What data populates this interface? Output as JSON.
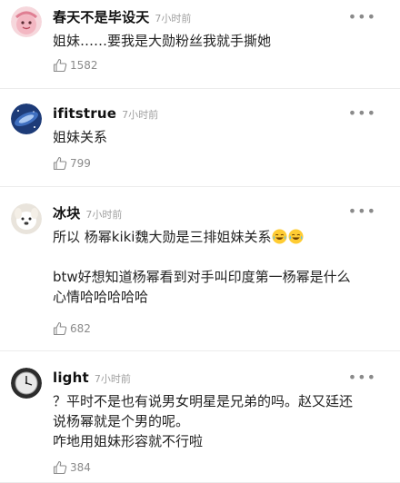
{
  "comments": [
    {
      "username": "春天不是毕设天",
      "time": "7小时前",
      "text_lines": [
        "姐妹……要我是大勋粉丝我就手撕她"
      ],
      "likes": "1582",
      "avatar_icon": "pink-character-avatar"
    },
    {
      "username": "ifitstrue",
      "time": "7小时前",
      "text_lines": [
        "姐妹关系"
      ],
      "likes": "799",
      "avatar_icon": "blue-galaxy-avatar"
    },
    {
      "username": "冰块",
      "time": "7小时前",
      "text_lines": [
        "所以 杨幂kiki魏大勋是三排姐妹关系",
        "",
        "btw好想知道杨幂看到对手叫印度第一杨幂是什么",
        "心情哈哈哈哈哈"
      ],
      "likes": "682",
      "avatar_icon": "white-dog-avatar"
    },
    {
      "username": "light",
      "time": "7小时前",
      "text_lines": [
        "？平时不是也有说男女明星是兄弟的吗。赵又廷还",
        "说杨幂就是个男的呢。",
        "咋地用姐妹形容就不行啦"
      ],
      "likes": "384",
      "avatar_icon": "clock-avatar"
    }
  ],
  "more_glyph": "•••",
  "colors": {
    "meta": "#a0a0a0",
    "divider": "#ececec",
    "text": "#222222"
  }
}
